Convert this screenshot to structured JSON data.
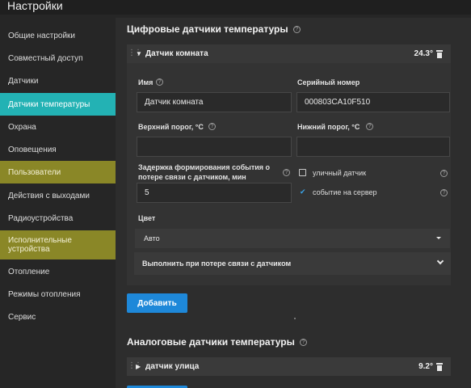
{
  "app": {
    "title": "Настройки"
  },
  "sidebar": {
    "items": [
      {
        "label": "Общие настройки"
      },
      {
        "label": "Совместный доступ"
      },
      {
        "label": "Датчики"
      },
      {
        "label": "Датчики температуры"
      },
      {
        "label": "Охрана"
      },
      {
        "label": "Оповещения"
      },
      {
        "label": "Пользователи"
      },
      {
        "label": "Действия с выходами"
      },
      {
        "label": "Радиоустройства"
      },
      {
        "label": "Исполнительные устройства"
      },
      {
        "label": "Отопление"
      },
      {
        "label": "Режимы отопления"
      },
      {
        "label": "Сервис"
      }
    ]
  },
  "digital": {
    "title": "Цифровые датчики температуры",
    "sensor": {
      "name": "Датчик комната",
      "value": "24.3°",
      "fields": {
        "name_label": "Имя",
        "name_value": "Датчик комната",
        "serial_label": "Серийный номер",
        "serial_value": "000803CA10F510",
        "upper_label": "Верхний порог, °C",
        "upper_value": "",
        "lower_label": "Нижний порог, °C",
        "lower_value": "",
        "delay_label": "Задержка формирования события о потере связи с датчиком, мин",
        "delay_value": "5",
        "outdoor_label": "уличный датчик",
        "outdoor_checked": false,
        "server_label": "событие на сервер",
        "server_checked": true,
        "color_label": "Цвет",
        "color_value": "Авто",
        "lost_action_label": "Выполнить при потере связи с датчиком"
      }
    },
    "add_button": "Добавить"
  },
  "analog": {
    "title": "Аналоговые датчики температуры",
    "sensor": {
      "name": "датчик улица",
      "value": "9.2°"
    }
  }
}
